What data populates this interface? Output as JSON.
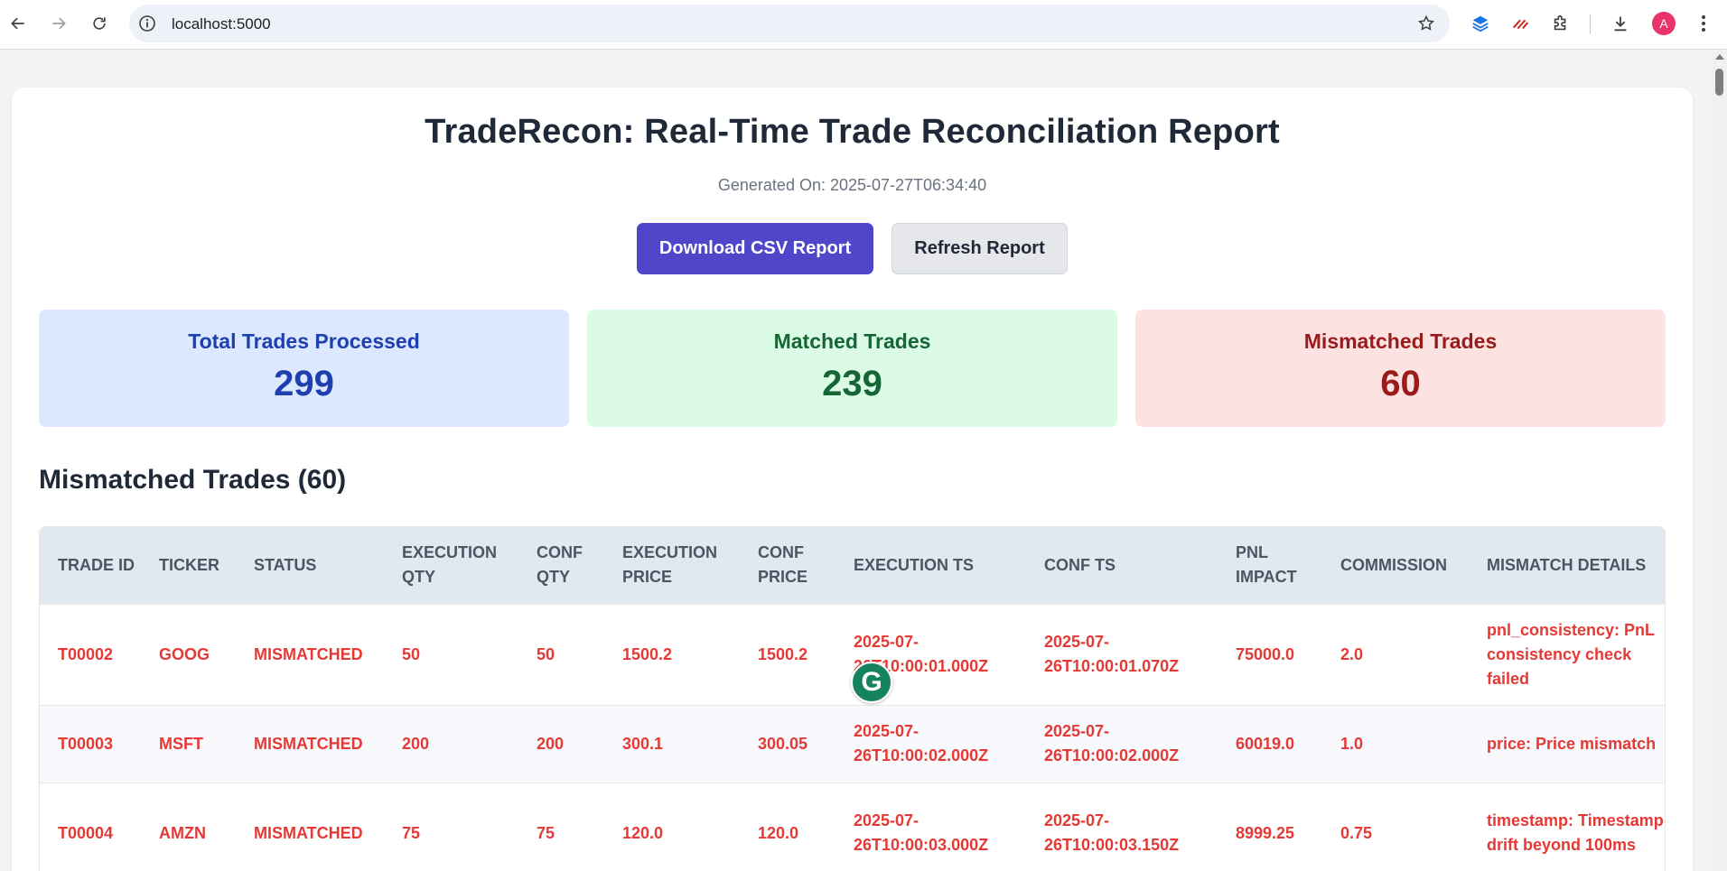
{
  "browser": {
    "url": "localhost:5000",
    "avatar_initial": "A"
  },
  "page": {
    "title": "TradeRecon: Real-Time Trade Reconciliation Report",
    "generated": "Generated On: 2025-07-27T06:34:40",
    "download_button": "Download CSV Report",
    "refresh_button": "Refresh Report"
  },
  "stats": {
    "total": {
      "label": "Total Trades Processed",
      "value": "299"
    },
    "matched": {
      "label": "Matched Trades",
      "value": "239"
    },
    "mismatched": {
      "label": "Mismatched Trades",
      "value": "60"
    }
  },
  "mismatch_section": {
    "heading": "Mismatched Trades (60)",
    "columns": [
      "Trade ID",
      "Ticker",
      "Status",
      "Execution Qty",
      "Conf Qty",
      "Execution Price",
      "Conf Price",
      "Execution TS",
      "Conf TS",
      "PnL Impact",
      "Commission",
      "Mismatch Details"
    ],
    "rows": [
      {
        "trade_id": "T00002",
        "ticker": "GOOG",
        "status": "MISMATCHED",
        "exec_qty": "50",
        "conf_qty": "50",
        "exec_price": "1500.2",
        "conf_price": "1500.2",
        "exec_ts": "2025-07-26T10:00:01.000Z",
        "conf_ts": "2025-07-26T10:00:01.070Z",
        "pnl": "75000.0",
        "commission": "2.0",
        "details": "pnl_consistency: PnL consistency check failed"
      },
      {
        "trade_id": "T00003",
        "ticker": "MSFT",
        "status": "MISMATCHED",
        "exec_qty": "200",
        "conf_qty": "200",
        "exec_price": "300.1",
        "conf_price": "300.05",
        "exec_ts": "2025-07-26T10:00:02.000Z",
        "conf_ts": "2025-07-26T10:00:02.000Z",
        "pnl": "60019.0",
        "commission": "1.0",
        "details": "price: Price mismatch"
      },
      {
        "trade_id": "T00004",
        "ticker": "AMZN",
        "status": "MISMATCHED",
        "exec_qty": "75",
        "conf_qty": "75",
        "exec_price": "120.0",
        "conf_price": "120.0",
        "exec_ts": "2025-07-26T10:00:03.000Z",
        "conf_ts": "2025-07-26T10:00:03.150Z",
        "pnl": "8999.25",
        "commission": "0.75",
        "details": "timestamp: Timestamp drift beyond 100ms"
      }
    ]
  },
  "overlay": {
    "grammarly_glyph": "G"
  },
  "colors": {
    "primary_button": "#4f46c9",
    "mismatch_text": "#e53935",
    "total_card": "#dbe8fd",
    "matched_card": "#dcfbe6",
    "mismatched_card": "#fde2e2"
  }
}
